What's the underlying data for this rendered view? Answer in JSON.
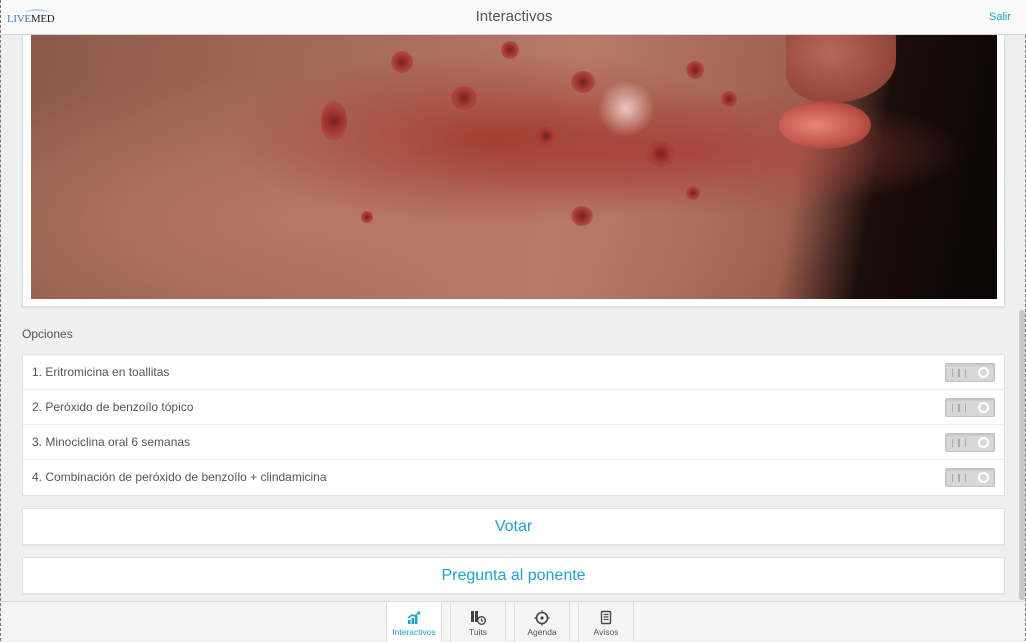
{
  "header": {
    "logo_part1": "LIVE",
    "logo_part2": "MED",
    "title": "Interactivos",
    "logout_label": "Salir"
  },
  "options": {
    "section_label": "Opciones",
    "items": [
      {
        "label": "1. Eritromicina en toallitas",
        "selected": false
      },
      {
        "label": "2. Peróxido de benzoílo tópico",
        "selected": false
      },
      {
        "label": "3. Minociclina oral 6 semanas",
        "selected": false
      },
      {
        "label": "4. Combinación de peróxido de benzoílo + clindamicina",
        "selected": false
      }
    ]
  },
  "actions": {
    "vote_label": "Votar",
    "ask_label": "Pregunta al ponente"
  },
  "tabbar": {
    "tabs": [
      {
        "label": "Interactivos",
        "icon": "chart-icon",
        "active": true
      },
      {
        "label": "Tuits",
        "icon": "tweets-icon",
        "active": false
      },
      {
        "label": "Agenda",
        "icon": "agenda-icon",
        "active": false
      },
      {
        "label": "Avisos",
        "icon": "notices-icon",
        "active": false
      }
    ]
  },
  "colors": {
    "accent": "#1aa3dd",
    "toggle_off": "#d7d7d7",
    "background": "#efefef"
  }
}
